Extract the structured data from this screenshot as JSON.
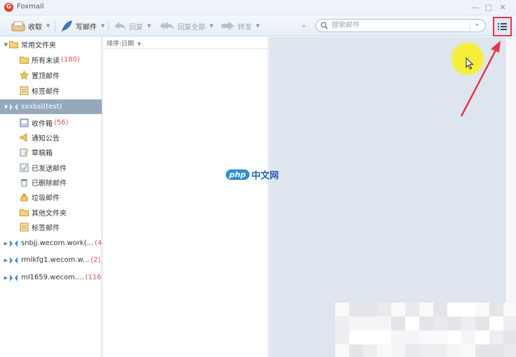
{
  "window": {
    "title": "Foxmail",
    "controls": [
      "—",
      "□",
      "✕"
    ]
  },
  "toolbar": {
    "receive": "收取",
    "compose": "写邮件",
    "reply": "回复",
    "reply_all": "回复全部",
    "forward": "转发",
    "more": "»"
  },
  "search": {
    "placeholder": "搜索邮件",
    "dropdown": "»"
  },
  "sidebar": {
    "common_folder": "常用文件夹",
    "all_unread": "所有未读",
    "all_unread_count": "(180)",
    "starred": "置顶邮件",
    "tagged": "标签邮件",
    "account1": "sxxbsl(test)",
    "inbox": "收件箱",
    "inbox_count": "(56)",
    "notice": "通知公告",
    "drafts": "草稿箱",
    "sent": "已发送邮件",
    "deleted": "已删除邮件",
    "spam": "垃圾邮件",
    "other_folders": "其他文件夹",
    "tagged2": "标签邮件",
    "account2": "snbjj.wecom.work(...",
    "account2_count": "(4)",
    "account3": "rmlkfg1.wecom.w...",
    "account3_count": "(2)",
    "account4": "ml1659.wecom....",
    "account4_count": "(116)"
  },
  "list": {
    "sort_label": "排序:日期"
  },
  "watermark": {
    "logo": "php",
    "text": "中文网"
  },
  "colors": {
    "accent": "#95a9bd",
    "annotation": "#e03a4a",
    "count": "#d9534f",
    "highlight": "#f5ef3a"
  }
}
